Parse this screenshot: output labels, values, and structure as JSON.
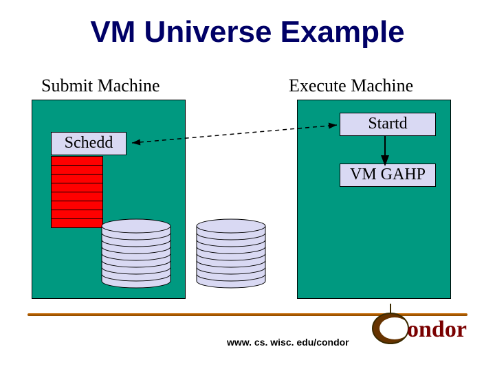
{
  "title": "VM Universe Example",
  "labels": {
    "submit": "Submit Machine",
    "execute": "Execute Machine"
  },
  "nodes": {
    "schedd": "Schedd",
    "startd": "Startd",
    "vmgahp": "VM GAHP"
  },
  "footer": {
    "url": "www. cs. wisc. edu/condor",
    "logo_text": "ondor",
    "logo_c": "C"
  },
  "colors": {
    "title": "#000066",
    "panel": "#009980",
    "node_bg": "#d9d9f3",
    "queue_item": "#ff0000"
  }
}
